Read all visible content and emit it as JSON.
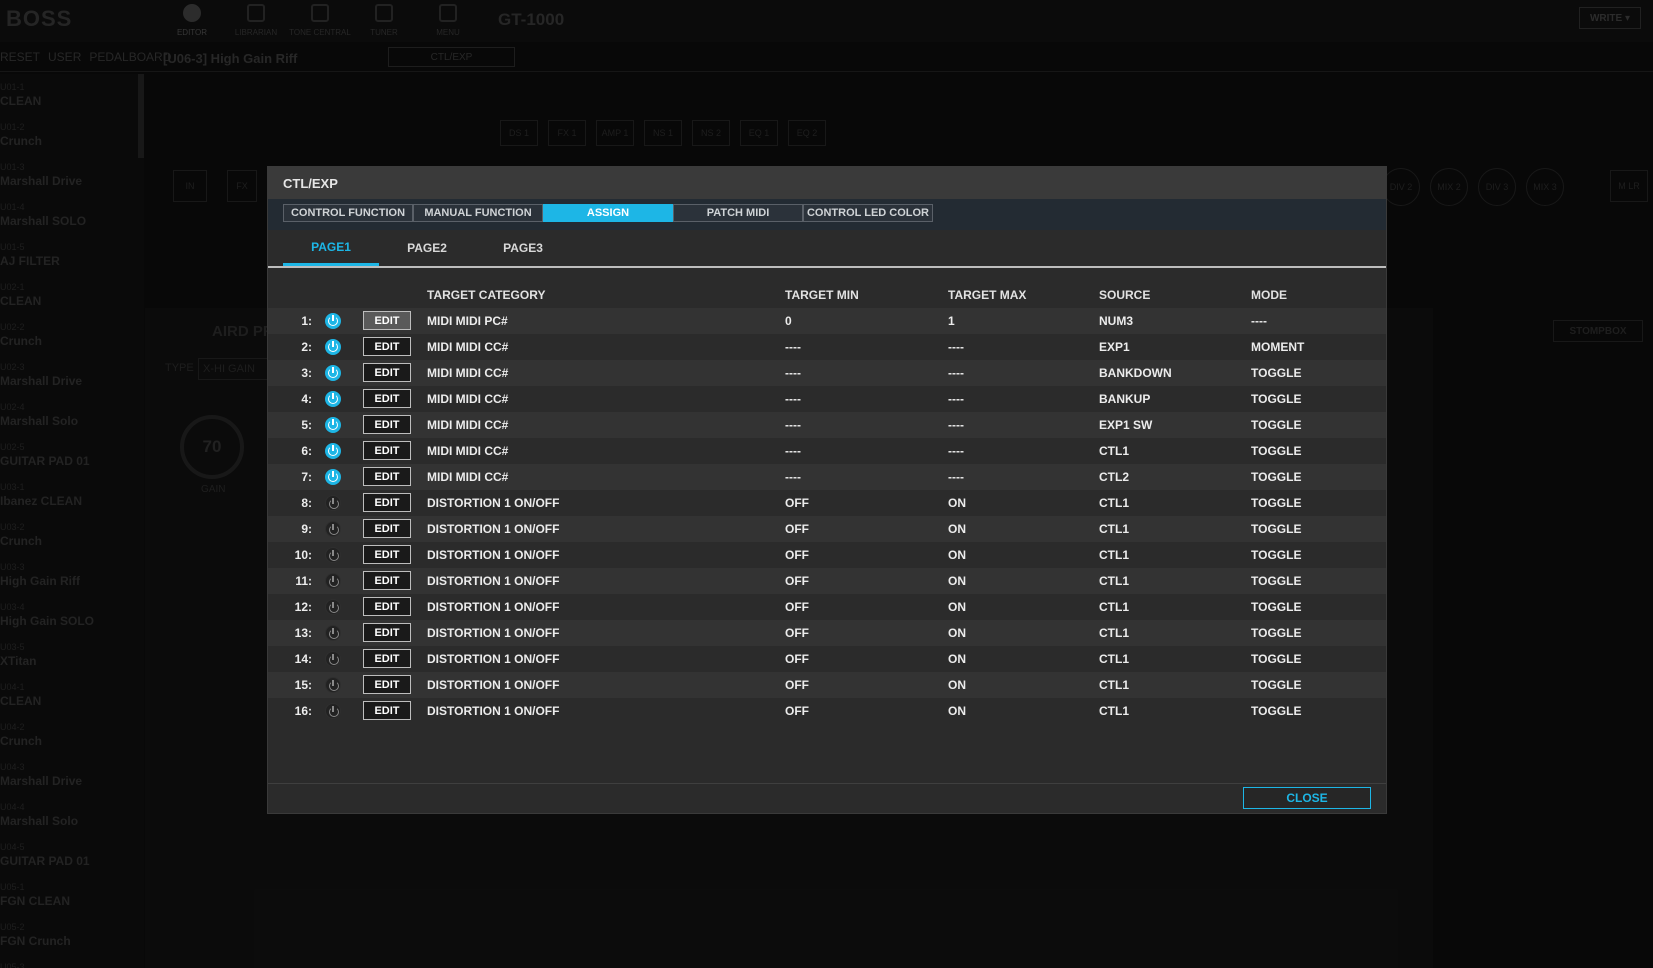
{
  "app": {
    "logo": "BOSS",
    "model": "GT-1000",
    "write_label": "WRITE ▾",
    "nav": [
      {
        "label": "EDITOR",
        "active": true,
        "icon": "knob-icon"
      },
      {
        "label": "LIBRARIAN",
        "active": false,
        "icon": "grid-icon"
      },
      {
        "label": "TONE CENTRAL",
        "active": false,
        "icon": "diamond-icon"
      },
      {
        "label": "TUNER",
        "active": false,
        "icon": "tuner-icon"
      },
      {
        "label": "MENU",
        "active": false,
        "icon": "menu-icon"
      }
    ],
    "subtabs": [
      "RESET",
      "USER",
      "PEDALBOARD"
    ],
    "patch_name": "[U06-3]  High Gain Riff",
    "ctl_box": "CTL/EXP"
  },
  "patches": [
    {
      "id": "U01-1",
      "name": "CLEAN"
    },
    {
      "id": "U01-2",
      "name": "Crunch"
    },
    {
      "id": "U01-3",
      "name": "Marshall Drive"
    },
    {
      "id": "U01-4",
      "name": "Marshall SOLO"
    },
    {
      "id": "U01-5",
      "name": "AJ FILTER"
    },
    {
      "id": "U02-1",
      "name": "CLEAN"
    },
    {
      "id": "U02-2",
      "name": "Crunch"
    },
    {
      "id": "U02-3",
      "name": "Marshall Drive"
    },
    {
      "id": "U02-4",
      "name": "Marshall Solo"
    },
    {
      "id": "U02-5",
      "name": "GUITAR PAD 01"
    },
    {
      "id": "U03-1",
      "name": "Ibanez CLEAN"
    },
    {
      "id": "U03-2",
      "name": "Crunch"
    },
    {
      "id": "U03-3",
      "name": "High Gain Riff"
    },
    {
      "id": "U03-4",
      "name": "High Gain SOLO"
    },
    {
      "id": "U03-5",
      "name": "XTitan"
    },
    {
      "id": "U04-1",
      "name": "CLEAN"
    },
    {
      "id": "U04-2",
      "name": "Crunch"
    },
    {
      "id": "U04-3",
      "name": "Marshall Drive"
    },
    {
      "id": "U04-4",
      "name": "Marshall Solo"
    },
    {
      "id": "U04-5",
      "name": "GUITAR PAD 01"
    },
    {
      "id": "U05-1",
      "name": "FGN CLEAN"
    },
    {
      "id": "U05-2",
      "name": "FGN Crunch"
    },
    {
      "id": "U05-3",
      "name": ""
    }
  ],
  "chain": {
    "blocks_top": [
      "DS 1",
      "FX 1",
      "AMP 1",
      "NS 1",
      "NS 2",
      "EQ 1",
      "EQ 2"
    ],
    "in_label": "IN",
    "fx_label": "FX",
    "circles": [
      "DIV 2",
      "MIX 2",
      "DIV 3",
      "MIX 3"
    ],
    "out_label": "M LR"
  },
  "amp": {
    "title": "AIRD PR",
    "type_label": "TYPE",
    "type_value": "X-HI GAIN",
    "gain_value": "70",
    "gain_label": "GAIN",
    "stompbox_label": "STOMPBOX"
  },
  "modal": {
    "title": "CTL/EXP",
    "tabs": [
      {
        "label": "CONTROL FUNCTION",
        "active": false
      },
      {
        "label": "MANUAL FUNCTION",
        "active": false
      },
      {
        "label": "ASSIGN",
        "active": true
      },
      {
        "label": "PATCH MIDI",
        "active": false
      },
      {
        "label": "CONTROL LED COLOR",
        "active": false
      }
    ],
    "pages": [
      {
        "label": "PAGE1",
        "active": true
      },
      {
        "label": "PAGE2",
        "active": false
      },
      {
        "label": "PAGE3",
        "active": false
      }
    ],
    "headers": {
      "category": "TARGET CATEGORY",
      "min": "TARGET MIN",
      "max": "TARGET MAX",
      "source": "SOURCE",
      "mode": "MODE"
    },
    "edit_label": "EDIT",
    "close_label": "CLOSE",
    "rows": [
      {
        "num": "1:",
        "on": true,
        "category": "MIDI MIDI PC#",
        "min": "0",
        "max": "1",
        "source": "NUM3",
        "mode": "----"
      },
      {
        "num": "2:",
        "on": true,
        "category": "MIDI MIDI CC#",
        "min": "----",
        "max": "----",
        "source": "EXP1",
        "mode": "MOMENT"
      },
      {
        "num": "3:",
        "on": true,
        "category": "MIDI MIDI CC#",
        "min": "----",
        "max": "----",
        "source": "BANKDOWN",
        "mode": "TOGGLE"
      },
      {
        "num": "4:",
        "on": true,
        "category": "MIDI MIDI CC#",
        "min": "----",
        "max": "----",
        "source": "BANKUP",
        "mode": "TOGGLE"
      },
      {
        "num": "5:",
        "on": true,
        "category": "MIDI MIDI CC#",
        "min": "----",
        "max": "----",
        "source": "EXP1 SW",
        "mode": "TOGGLE"
      },
      {
        "num": "6:",
        "on": true,
        "category": "MIDI MIDI CC#",
        "min": "----",
        "max": "----",
        "source": "CTL1",
        "mode": "TOGGLE"
      },
      {
        "num": "7:",
        "on": true,
        "category": "MIDI MIDI CC#",
        "min": "----",
        "max": "----",
        "source": "CTL2",
        "mode": "TOGGLE"
      },
      {
        "num": "8:",
        "on": false,
        "category": "DISTORTION 1 ON/OFF",
        "min": "OFF",
        "max": "ON",
        "source": "CTL1",
        "mode": "TOGGLE"
      },
      {
        "num": "9:",
        "on": false,
        "category": "DISTORTION 1 ON/OFF",
        "min": "OFF",
        "max": "ON",
        "source": "CTL1",
        "mode": "TOGGLE"
      },
      {
        "num": "10:",
        "on": false,
        "category": "DISTORTION 1 ON/OFF",
        "min": "OFF",
        "max": "ON",
        "source": "CTL1",
        "mode": "TOGGLE"
      },
      {
        "num": "11:",
        "on": false,
        "category": "DISTORTION 1 ON/OFF",
        "min": "OFF",
        "max": "ON",
        "source": "CTL1",
        "mode": "TOGGLE"
      },
      {
        "num": "12:",
        "on": false,
        "category": "DISTORTION 1 ON/OFF",
        "min": "OFF",
        "max": "ON",
        "source": "CTL1",
        "mode": "TOGGLE"
      },
      {
        "num": "13:",
        "on": false,
        "category": "DISTORTION 1 ON/OFF",
        "min": "OFF",
        "max": "ON",
        "source": "CTL1",
        "mode": "TOGGLE"
      },
      {
        "num": "14:",
        "on": false,
        "category": "DISTORTION 1 ON/OFF",
        "min": "OFF",
        "max": "ON",
        "source": "CTL1",
        "mode": "TOGGLE"
      },
      {
        "num": "15:",
        "on": false,
        "category": "DISTORTION 1 ON/OFF",
        "min": "OFF",
        "max": "ON",
        "source": "CTL1",
        "mode": "TOGGLE"
      },
      {
        "num": "16:",
        "on": false,
        "category": "DISTORTION 1 ON/OFF",
        "min": "OFF",
        "max": "ON",
        "source": "CTL1",
        "mode": "TOGGLE"
      }
    ]
  },
  "colors": {
    "accent": "#1db6e6",
    "modal_bg": "#2b2b2b",
    "row_alt": "#333333"
  }
}
